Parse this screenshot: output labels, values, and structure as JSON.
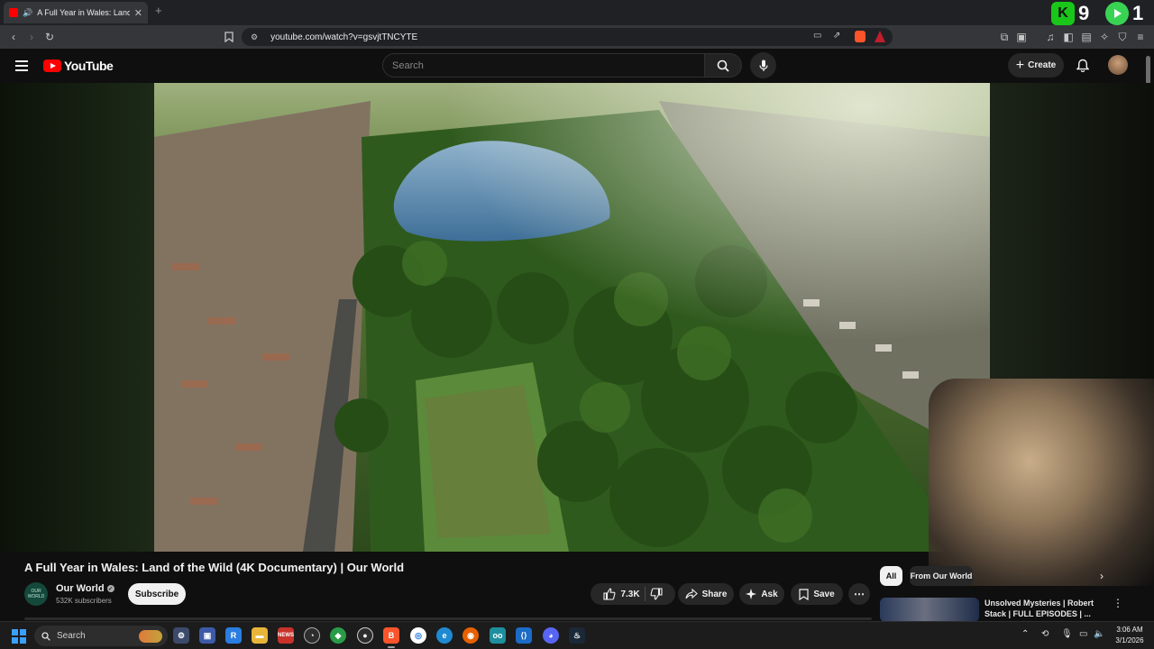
{
  "browser": {
    "tab": {
      "title": "A Full Year in Wales: Land of t"
    },
    "url": "youtube.com/watch?v=gsvjtTNCYTE",
    "score_left": "9",
    "score_right": "1"
  },
  "youtube": {
    "logo_text": "YouTube",
    "search_placeholder": "Search",
    "create_label": "Create"
  },
  "video": {
    "title": "A Full Year in Wales: Land of the Wild (4K Documentary) | Our World",
    "channel": {
      "name": "Our World",
      "avatar_text": "OUR WORLD",
      "subscribers": "532K subscribers"
    },
    "subscribe_label": "Subscribe",
    "likes": "7.3K",
    "share_label": "Share",
    "ask_label": "Ask",
    "save_label": "Save"
  },
  "sidebar": {
    "chips": [
      "All",
      "From Our World"
    ],
    "recommendation": {
      "title": "Unsolved Mysteries | Robert Stack | FULL EPISODES | ..."
    }
  },
  "taskbar": {
    "search_label": "Search",
    "time": "3:06 AM",
    "date": "3/1/2026"
  },
  "colors": {
    "youtube_red": "#ff0000",
    "background": "#0f0f0f",
    "pill": "#272727",
    "accent_green": "#19c619"
  }
}
